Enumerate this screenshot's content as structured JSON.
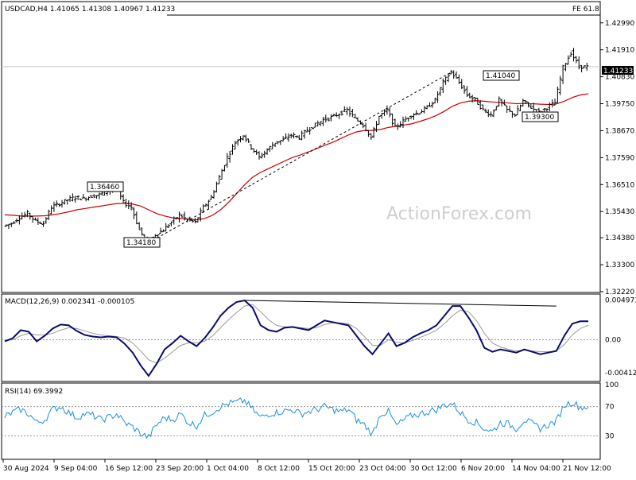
{
  "header": {
    "symbol_line": "USDCAD,H4  1.41065 1.41308 1.40967 1.41233",
    "fe_label": "FE 61.8",
    "watermark": "ActionForex.com"
  },
  "price_panel": {
    "current_price": "1.41233",
    "ylim": [
      1.3222,
      1.4381
    ],
    "ticks": [
      "1.42990",
      "1.41910",
      "1.40830",
      "1.39750",
      "1.38670",
      "1.37590",
      "1.36510",
      "1.35430",
      "1.34380",
      "1.33300",
      "1.32220"
    ],
    "fe_level": 1.433,
    "annotations": [
      {
        "text": "1.36460",
        "value": 1.3646
      },
      {
        "text": "1.34180",
        "value": 1.3418
      },
      {
        "text": "1.41040",
        "value": 1.4104
      },
      {
        "text": "1.39300",
        "value": 1.393
      }
    ]
  },
  "macd_panel": {
    "label": "MACD(12,26,9) 0.002341 -0.000105",
    "ticks": [
      "0.004971",
      "0.00",
      "-0.004126"
    ],
    "ylim": [
      -0.005,
      0.0055
    ]
  },
  "rsi_panel": {
    "label": "RSI(14) 69.3992",
    "ticks": [
      "100",
      "70",
      "30",
      "0"
    ],
    "ylim": [
      0,
      100
    ]
  },
  "x_axis": {
    "labels": [
      "30 Aug 2024",
      "9 Sep 04:00",
      "16 Sep 12:00",
      "23 Sep 20:00",
      "1 Oct 04:00",
      "8 Oct 12:00",
      "15 Oct 20:00",
      "23 Oct 04:00",
      "30 Oct 12:00",
      "6 Nov 20:00",
      "14 Nov 04:00",
      "21 Nov 12:00"
    ]
  },
  "chart_data": {
    "type": "line",
    "title": "USDCAD,H4",
    "x": [
      0,
      1,
      2,
      3,
      4,
      5,
      6,
      7,
      8,
      9,
      10,
      11,
      12,
      13,
      14,
      15,
      16,
      17,
      18,
      19,
      20,
      21,
      22,
      23,
      24,
      25,
      26,
      27,
      28,
      29,
      30,
      31,
      32,
      33,
      34,
      35,
      36,
      37,
      38,
      39,
      40,
      41,
      42,
      43,
      44,
      45,
      46,
      47,
      48,
      49,
      50,
      51,
      52,
      53,
      54,
      55,
      56,
      57,
      58,
      59,
      60,
      61,
      62,
      63,
      64,
      65,
      66,
      67,
      68,
      69,
      70,
      71,
      72,
      73
    ],
    "series": [
      {
        "name": "close",
        "values": [
          1.3485,
          1.3495,
          1.352,
          1.3535,
          1.3505,
          1.3495,
          1.356,
          1.3575,
          1.359,
          1.36,
          1.3595,
          1.3605,
          1.361,
          1.3625,
          1.3646,
          1.358,
          1.356,
          1.347,
          1.3418,
          1.345,
          1.347,
          1.35,
          1.353,
          1.351,
          1.35,
          1.356,
          1.36,
          1.368,
          1.376,
          1.382,
          1.385,
          1.38,
          1.376,
          1.379,
          1.382,
          1.383,
          1.385,
          1.384,
          1.387,
          1.389,
          1.391,
          1.392,
          1.3935,
          1.395,
          1.3915,
          1.389,
          1.384,
          1.3925,
          1.395,
          1.388,
          1.3905,
          1.393,
          1.394,
          1.396,
          1.399,
          1.406,
          1.4104,
          1.406,
          1.401,
          1.399,
          1.395,
          1.393,
          1.399,
          1.395,
          1.393,
          1.3985,
          1.396,
          1.394,
          1.396,
          1.398,
          1.412,
          1.418,
          1.4123,
          1.4123
        ]
      },
      {
        "name": "ma",
        "values": [
          1.353,
          1.3528,
          1.3525,
          1.3525,
          1.3525,
          1.3526,
          1.353,
          1.3535,
          1.3542,
          1.355,
          1.3555,
          1.356,
          1.3565,
          1.357,
          1.3575,
          1.3576,
          1.3573,
          1.3565,
          1.355,
          1.3535,
          1.3525,
          1.3518,
          1.3515,
          1.3512,
          1.351,
          1.3515,
          1.3528,
          1.355,
          1.358,
          1.3615,
          1.365,
          1.368,
          1.37,
          1.3715,
          1.373,
          1.3745,
          1.376,
          1.377,
          1.3782,
          1.3795,
          1.3808,
          1.382,
          1.3835,
          1.385,
          1.3862,
          1.3868,
          1.3868,
          1.3872,
          1.388,
          1.3885,
          1.389,
          1.3895,
          1.3905,
          1.3915,
          1.3928,
          1.3945,
          1.3965,
          1.3978,
          1.3985,
          1.3987,
          1.3985,
          1.3982,
          1.398,
          1.3978,
          1.3975,
          1.3976,
          1.3975,
          1.3973,
          1.3972,
          1.3974,
          1.3985,
          1.4,
          1.401,
          1.4015
        ]
      },
      {
        "name": "macd",
        "values": [
          -0.0002,
          0.0002,
          0.0012,
          0.001,
          -0.0002,
          0.0005,
          0.0014,
          0.0019,
          0.0018,
          0.0011,
          0.0006,
          0.0004,
          0.0003,
          0.0004,
          0.0003,
          -0.0005,
          -0.0016,
          -0.0032,
          -0.0045,
          -0.003,
          -0.0012,
          -0.0004,
          0.0005,
          -0.0002,
          -0.0008,
          0.0002,
          0.0015,
          0.003,
          0.004,
          0.0047,
          0.0049,
          0.004,
          0.0018,
          0.0012,
          0.001,
          0.0015,
          0.0016,
          0.0014,
          0.0012,
          0.0018,
          0.0024,
          0.0022,
          0.002,
          0.0018,
          0.0005,
          -0.0008,
          -0.0018,
          -0.0005,
          0.0008,
          -0.0008,
          -0.0004,
          0.0003,
          0.0008,
          0.0012,
          0.0018,
          0.003,
          0.0042,
          0.0042,
          0.0028,
          0.0012,
          -0.001,
          -0.0015,
          -0.0012,
          -0.0014,
          -0.0016,
          -0.0012,
          -0.0015,
          -0.0018,
          -0.0016,
          -0.0014,
          0.0005,
          0.002,
          0.0023,
          0.0023
        ]
      },
      {
        "name": "signal",
        "values": [
          -0.0001,
          0.0,
          0.0005,
          0.0008,
          0.0006,
          0.0006,
          0.0008,
          0.0012,
          0.0015,
          0.0014,
          0.0011,
          0.0008,
          0.0006,
          0.0005,
          0.0004,
          0.0002,
          -0.0004,
          -0.0014,
          -0.0025,
          -0.0029,
          -0.0023,
          -0.0015,
          -0.0007,
          -0.0004,
          -0.0004,
          -0.0002,
          0.0005,
          0.0015,
          0.0025,
          0.0034,
          0.0042,
          0.0044,
          0.0035,
          0.0025,
          0.0018,
          0.0016,
          0.0016,
          0.0015,
          0.0014,
          0.0015,
          0.0019,
          0.0021,
          0.0021,
          0.002,
          0.0014,
          0.0004,
          -0.0007,
          -0.0007,
          0.0,
          -0.0003,
          -0.0004,
          -0.0001,
          0.0003,
          0.0007,
          0.0012,
          0.002,
          0.003,
          0.0037,
          0.0035,
          0.0024,
          0.0008,
          -0.0004,
          -0.0009,
          -0.0012,
          -0.0014,
          -0.0013,
          -0.0014,
          -0.0015,
          -0.0015,
          -0.0014,
          -0.0006,
          0.0006,
          0.0014,
          0.0018
        ]
      },
      {
        "name": "rsi",
        "values": [
          56,
          62,
          66,
          60,
          48,
          52,
          66,
          70,
          62,
          55,
          60,
          58,
          52,
          55,
          60,
          48,
          42,
          33,
          28,
          45,
          55,
          52,
          60,
          48,
          44,
          58,
          63,
          70,
          74,
          76,
          78,
          66,
          55,
          60,
          62,
          64,
          66,
          60,
          63,
          66,
          70,
          66,
          63,
          66,
          52,
          45,
          32,
          60,
          63,
          44,
          52,
          58,
          60,
          63,
          66,
          72,
          74,
          62,
          52,
          48,
          40,
          36,
          48,
          46,
          40,
          52,
          46,
          40,
          45,
          50,
          72,
          76,
          69,
          69
        ]
      }
    ]
  }
}
